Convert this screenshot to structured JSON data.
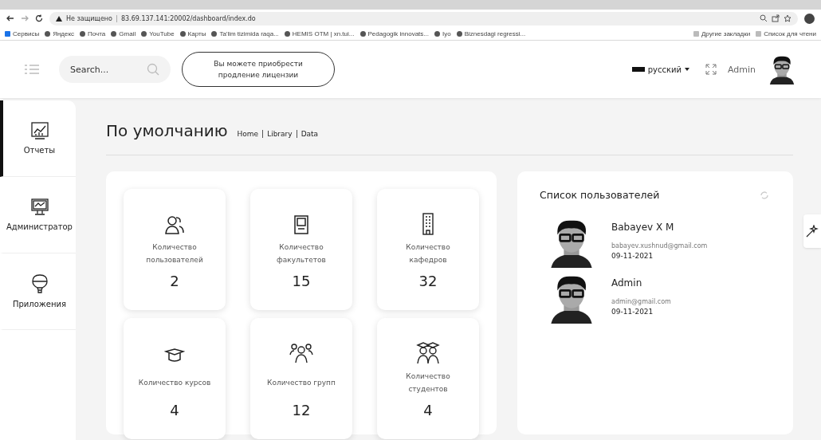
{
  "browser": {
    "security": "Не защищено",
    "url": "83.69.137.141:20002/dashboard/index.do",
    "bookmarks": [
      "Сервисы",
      "Яндекс",
      "Почта",
      "Gmail",
      "YouTube",
      "Карты",
      "Ta'lim tizimida raqa...",
      "HEMIS OTM | xn.tui...",
      "Pedagogik innovats...",
      "Iyo",
      "Biznesdagi regressi..."
    ],
    "bookmarks_right": [
      "Другие закладки",
      "Список для чтени"
    ]
  },
  "header": {
    "search": {
      "placeholder": "Search..."
    },
    "license_button": "Вы можете приобрести продление лицензии",
    "language": "русский",
    "user": "Admin"
  },
  "sidebar": {
    "items": [
      {
        "label": "Отчеты",
        "kind": "chart",
        "selected": true
      },
      {
        "label": "Администратор",
        "kind": "monitor",
        "selected": false
      },
      {
        "label": "Приложения",
        "kind": "balloon",
        "selected": false
      }
    ]
  },
  "page": {
    "title": "По умолчанию",
    "breadcrumb": [
      "Home",
      "Library",
      "Data"
    ]
  },
  "stats": [
    {
      "kind": "users",
      "label": "Количество пользователей",
      "value": "2"
    },
    {
      "kind": "door",
      "label": "Количество факультетов",
      "value": "15"
    },
    {
      "kind": "building",
      "label": "Количество кафедров",
      "value": "32"
    },
    {
      "kind": "cap",
      "label": "Количество курсов",
      "value": "4"
    },
    {
      "kind": "group",
      "label": "Количество групп",
      "value": "12"
    },
    {
      "kind": "students",
      "label": "Количество студентов",
      "value": "4"
    }
  ],
  "users_panel": {
    "title": "Список пользователей",
    "users": [
      {
        "name": "Babayev X M",
        "email": "babayev.xushnud@gmail.com",
        "date": "09-11-2021"
      },
      {
        "name": "Admin",
        "email": "admin@gmail.com",
        "date": "09-11-2021"
      }
    ]
  }
}
